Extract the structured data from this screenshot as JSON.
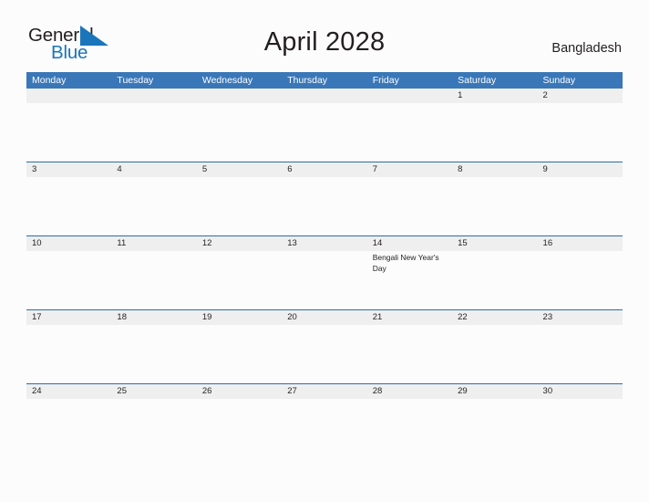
{
  "brand": {
    "word_one": "General",
    "word_two": "Blue",
    "flag_icon": "blue-triangle-flag",
    "color_dark": "#231f20",
    "color_blue": "#1b75bb"
  },
  "header": {
    "title": "April 2028",
    "region": "Bangladesh"
  },
  "calendar": {
    "accent_color": "#3a77b8",
    "rule_color": "#2e6da4",
    "band_color": "#efefef",
    "day_headers": [
      "Monday",
      "Tuesday",
      "Wednesday",
      "Thursday",
      "Friday",
      "Saturday",
      "Sunday"
    ],
    "weeks": [
      [
        {
          "date": "",
          "event": ""
        },
        {
          "date": "",
          "event": ""
        },
        {
          "date": "",
          "event": ""
        },
        {
          "date": "",
          "event": ""
        },
        {
          "date": "",
          "event": ""
        },
        {
          "date": "1",
          "event": ""
        },
        {
          "date": "2",
          "event": ""
        }
      ],
      [
        {
          "date": "3",
          "event": ""
        },
        {
          "date": "4",
          "event": ""
        },
        {
          "date": "5",
          "event": ""
        },
        {
          "date": "6",
          "event": ""
        },
        {
          "date": "7",
          "event": ""
        },
        {
          "date": "8",
          "event": ""
        },
        {
          "date": "9",
          "event": ""
        }
      ],
      [
        {
          "date": "10",
          "event": ""
        },
        {
          "date": "11",
          "event": ""
        },
        {
          "date": "12",
          "event": ""
        },
        {
          "date": "13",
          "event": ""
        },
        {
          "date": "14",
          "event": "Bengali New Year's Day"
        },
        {
          "date": "15",
          "event": ""
        },
        {
          "date": "16",
          "event": ""
        }
      ],
      [
        {
          "date": "17",
          "event": ""
        },
        {
          "date": "18",
          "event": ""
        },
        {
          "date": "19",
          "event": ""
        },
        {
          "date": "20",
          "event": ""
        },
        {
          "date": "21",
          "event": ""
        },
        {
          "date": "22",
          "event": ""
        },
        {
          "date": "23",
          "event": ""
        }
      ],
      [
        {
          "date": "24",
          "event": ""
        },
        {
          "date": "25",
          "event": ""
        },
        {
          "date": "26",
          "event": ""
        },
        {
          "date": "27",
          "event": ""
        },
        {
          "date": "28",
          "event": ""
        },
        {
          "date": "29",
          "event": ""
        },
        {
          "date": "30",
          "event": ""
        }
      ]
    ]
  }
}
